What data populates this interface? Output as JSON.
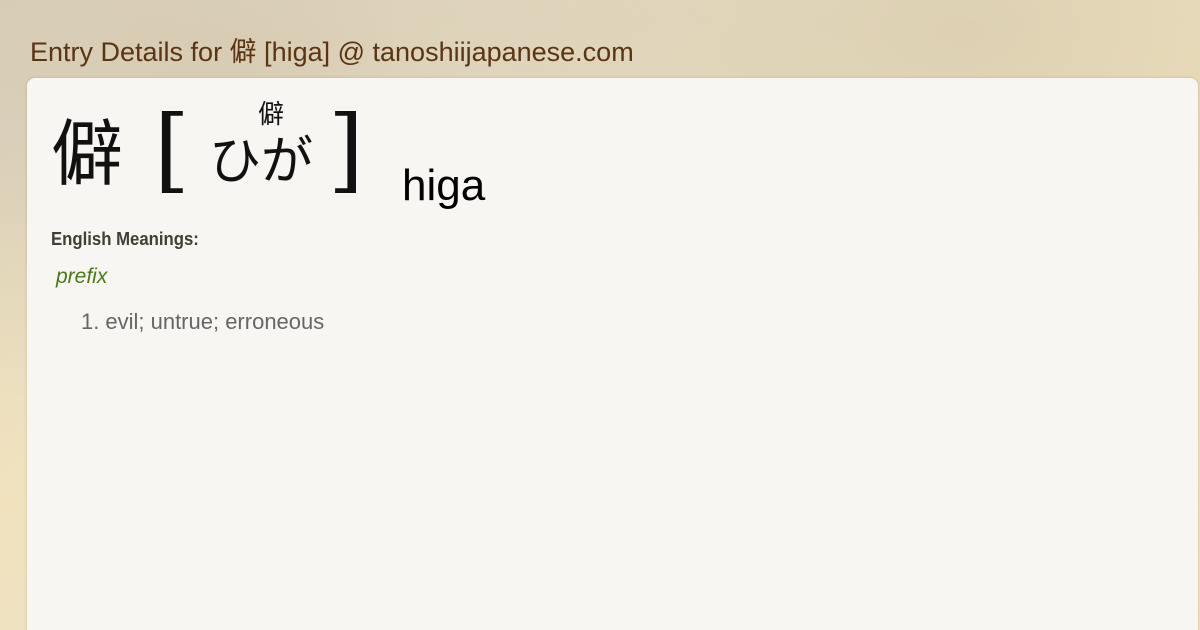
{
  "page": {
    "title": "Entry Details for 僻 [higa] @ tanoshiijapanese.com"
  },
  "entry": {
    "kanji": "僻",
    "bracket_open": "[",
    "bracket_close": "]",
    "furigana_kanji": "僻",
    "reading": "ひが",
    "romaji": "higa"
  },
  "meanings": {
    "heading": "English Meanings:",
    "part_of_speech": "prefix",
    "items": [
      {
        "number": "1.",
        "text": "evil; untrue; erroneous"
      }
    ]
  },
  "colors": {
    "title": "#5a3413",
    "pos": "#4a7a16",
    "meaning": "#666666",
    "card": "#f7f6f2"
  }
}
